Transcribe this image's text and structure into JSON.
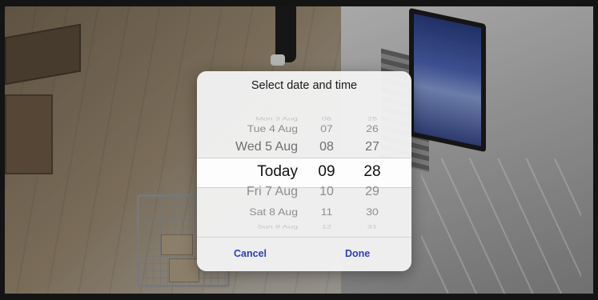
{
  "dialog": {
    "title": "Select date and time",
    "cancel_label": "Cancel",
    "done_label": "Done"
  },
  "picker": {
    "rows": [
      {
        "day": "Mon 3 Aug",
        "hour": "06",
        "minute": "25"
      },
      {
        "day": "Tue 4 Aug",
        "hour": "07",
        "minute": "26"
      },
      {
        "day": "Wed 5 Aug",
        "hour": "08",
        "minute": "27"
      },
      {
        "day": "Today",
        "hour": "09",
        "minute": "28"
      },
      {
        "day": "Fri 7 Aug",
        "hour": "10",
        "minute": "29"
      },
      {
        "day": "Sat 8 Aug",
        "hour": "11",
        "minute": "30"
      },
      {
        "day": "Sun 9 Aug",
        "hour": "12",
        "minute": "31"
      }
    ],
    "selected_index": 3
  },
  "colors": {
    "accent": "#2e3ebc",
    "dialog_bg": "#f2f2f2",
    "selected_text": "#111111",
    "faint_text": "#b5b5b5"
  }
}
